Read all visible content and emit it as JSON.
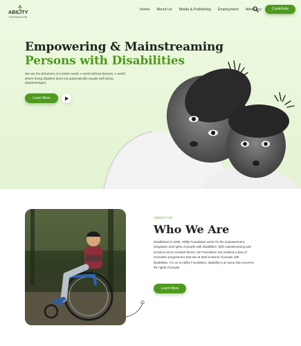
{
  "brand": {
    "name": "ABILITY",
    "sub": "FOUNDATION",
    "accent": "#4e9a1f"
  },
  "nav": {
    "items": [
      "Home",
      "About Us",
      "Media & Publishing",
      "Employment",
      "Advocacy"
    ],
    "search_icon": "search-icon",
    "cta": "Contribute"
  },
  "hero": {
    "title_line1": "Empowering & Mainstreaming",
    "title_line2": "Persons with Disabilities",
    "description": "We are the dreamers of a better world. A world without barriers. A world where being disabled does not automatically equate with being disadvantaged.",
    "button": "Learn More",
    "play_icon": "play-icon"
  },
  "about": {
    "label": "ABOUT US",
    "title": "Who We Are",
    "text": "Established in 1995, Ability Foundation works for the empowerment, integration and rights of people with disabilities. With mainstreaming and inclusion as its constant theme, the Foundation has initiated a slew of innovative programmes that aim at total inclusion of people with disabilities. For us at Ability Foundation, disability is an issue that concerns the rights of people.",
    "button": "Learn More"
  }
}
